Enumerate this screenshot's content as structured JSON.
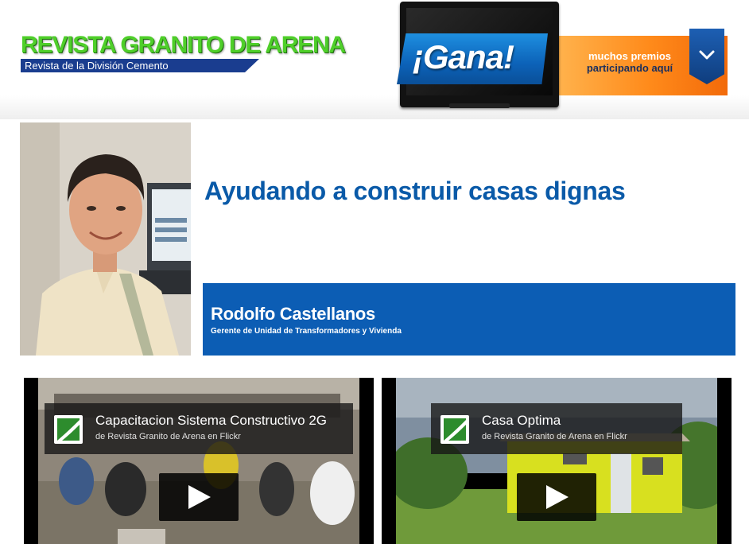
{
  "header": {
    "logo_title": "REVISTA GRANITO DE ARENA",
    "logo_subtitle": "Revista de la División Cemento"
  },
  "promo": {
    "headline": "¡Gana!",
    "line1": "muchos premios",
    "line2": "participando aquí",
    "icon": "chevron-down-icon",
    "colors": {
      "orange": "#ff8a1a",
      "blue": "#0c62b8"
    }
  },
  "article": {
    "title": "Ayudando a construir casas dignas",
    "author_name": "Rodolfo Castellanos",
    "author_role": "Gerente de Unidad de Transformadores y Vivienda",
    "accent_color": "#0c5db4"
  },
  "videos": [
    {
      "title": "Capacitacion Sistema Constructivo 2G",
      "byline": "de Revista Granito de Arena en Flickr"
    },
    {
      "title": "Casa Optima",
      "byline": "de Revista Granito de Arena en Flickr"
    }
  ]
}
